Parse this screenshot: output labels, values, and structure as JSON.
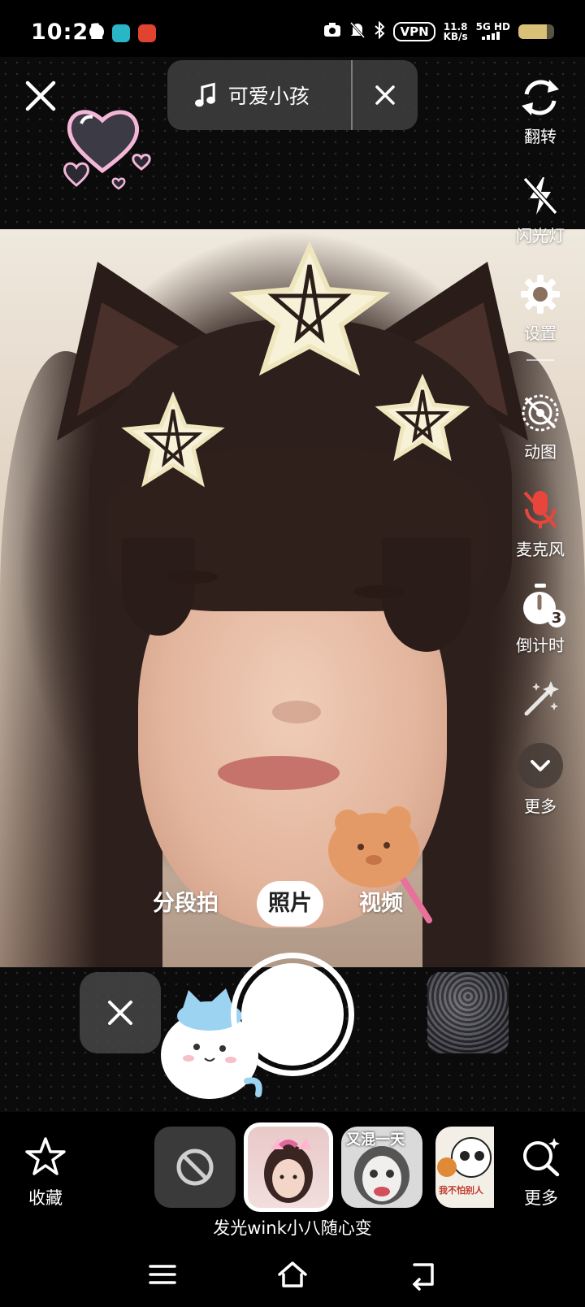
{
  "status_bar": {
    "time": "10:21",
    "vpn": "VPN",
    "speed_value": "11.8",
    "speed_unit": "KB/s",
    "network": "5G HD"
  },
  "music": {
    "title": "可爱小孩"
  },
  "toolbar": {
    "flip_label": "翻转",
    "flash_label": "闪光灯",
    "settings_label": "设置",
    "gif_label": "动图",
    "mic_label": "麦克风",
    "timer_label": "倒计时",
    "timer_value": "3",
    "more_label": "更多"
  },
  "modes": {
    "segment": "分段拍",
    "photo": "照片",
    "video": "视频",
    "selected": "照片"
  },
  "effects": {
    "favorite_label": "收藏",
    "more_label": "更多",
    "thumb2_caption": "又混一天",
    "thumb3_caption": "我不怕别人",
    "current_name": "发光wink小八随心变"
  },
  "colors": {
    "mic_muted": "#e8463c",
    "accent_white": "#ffffff",
    "pill_bg": "#3c3c3c"
  }
}
